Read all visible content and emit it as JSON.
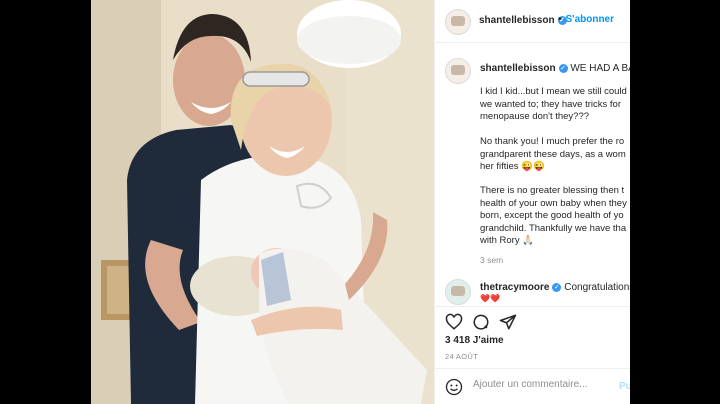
{
  "post": {
    "header": {
      "username": "shantellebisson",
      "follow_separator": "•",
      "follow_label": "S'abonner"
    },
    "caption": {
      "username": "shantellebisson",
      "first_line": "WE HAD A BAB",
      "para1": "I kid I kid...but I mean we still could\nwe wanted to; they have tricks for\nmenopause don't they???",
      "para2": "No thank you! I much prefer the ro\ngrandparent these days, as a wom\nher fifties 😜😜",
      "para3": "There is no greater blessing then t\nhealth of your own baby when they\nborn, except the good health of yo\ngrandchild. Thankfully we have tha\nwith Rory 🙏🏻",
      "time": "3 sem"
    },
    "comment": {
      "username": "thetracymoore",
      "text": "Congratulations",
      "emoji": "❤️❤️"
    },
    "likes": "3 418 J'aime",
    "date": "24 AOÛT",
    "add_comment": {
      "placeholder": "Ajouter un commentaire...",
      "publish_label": "Pu"
    }
  },
  "colors": {
    "verified": "#3897f0",
    "link": "#0095f6",
    "background": "#000000"
  }
}
